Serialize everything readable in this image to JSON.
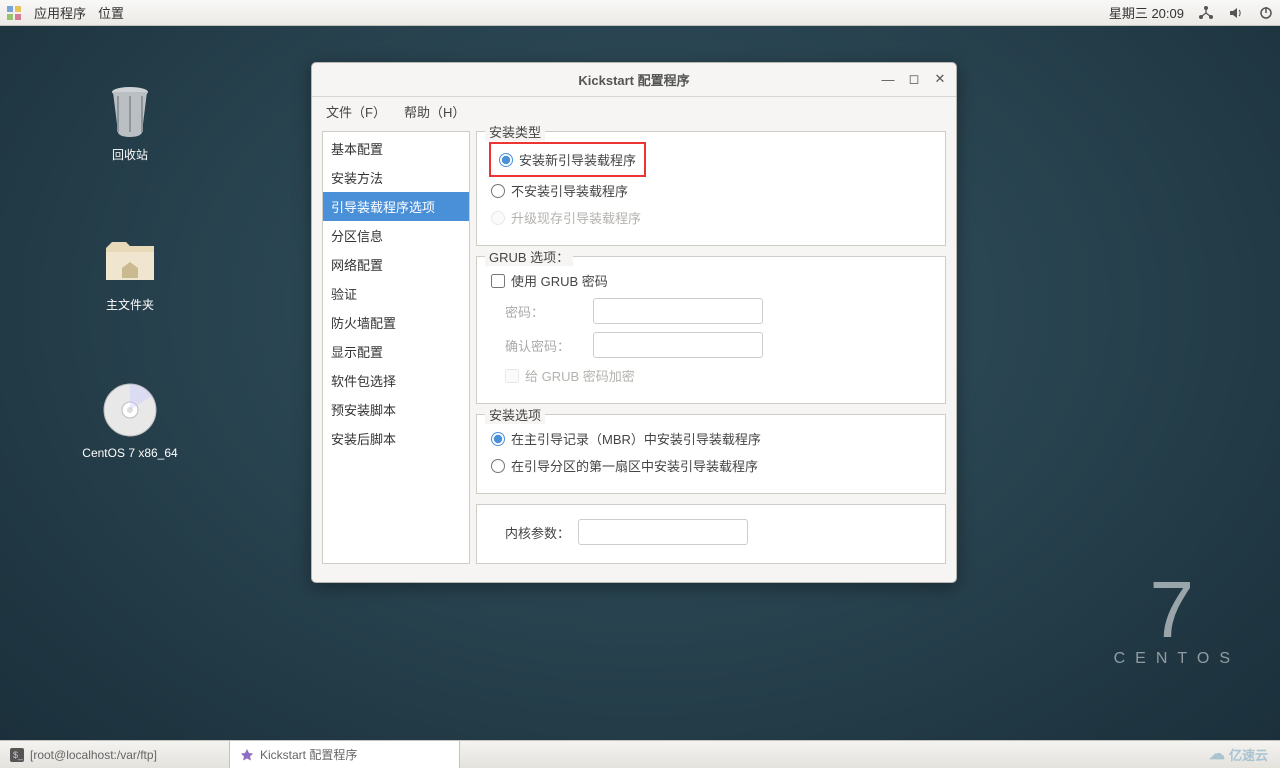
{
  "panel": {
    "apps": "应用程序",
    "places": "位置",
    "datetime": "星期三 20:09"
  },
  "desktop": {
    "trash": "回收站",
    "home": "主文件夹",
    "cd": "CentOS 7 x86_64"
  },
  "window": {
    "title": "Kickstart 配置程序",
    "menu_file": "文件（F）",
    "menu_help": "帮助（H）"
  },
  "sidebar": {
    "items": [
      "基本配置",
      "安装方法",
      "引导装载程序选项",
      "分区信息",
      "网络配置",
      "验证",
      "防火墙配置",
      "显示配置",
      "软件包选择",
      "预安装脚本",
      "安装后脚本"
    ],
    "selected_index": 2
  },
  "group_install_type": {
    "title": "安装类型",
    "opt_new": "安装新引导装载程序",
    "opt_none": "不安装引导装载程序",
    "opt_upgrade": "升级现存引导装载程序"
  },
  "group_grub": {
    "title": "GRUB 选项：",
    "use_pw": "使用  GRUB 密码",
    "pw_label": "密码：",
    "pw_confirm_label": "确认密码：",
    "encrypt": "给 GRUB 密码加密"
  },
  "group_install_opt": {
    "title": "安装选项",
    "opt_mbr": "在主引导记录（MBR）中安装引导装载程序",
    "opt_first_sector": "在引导分区的第一扇区中安装引导装载程序"
  },
  "kernel": {
    "label": "内核参数：",
    "value": ""
  },
  "centos": {
    "seven": "7",
    "name": "CENTOS"
  },
  "taskbar": {
    "term": "[root@localhost:/var/ftp]",
    "kickstart": "Kickstart 配置程序"
  },
  "provider": "亿速云"
}
